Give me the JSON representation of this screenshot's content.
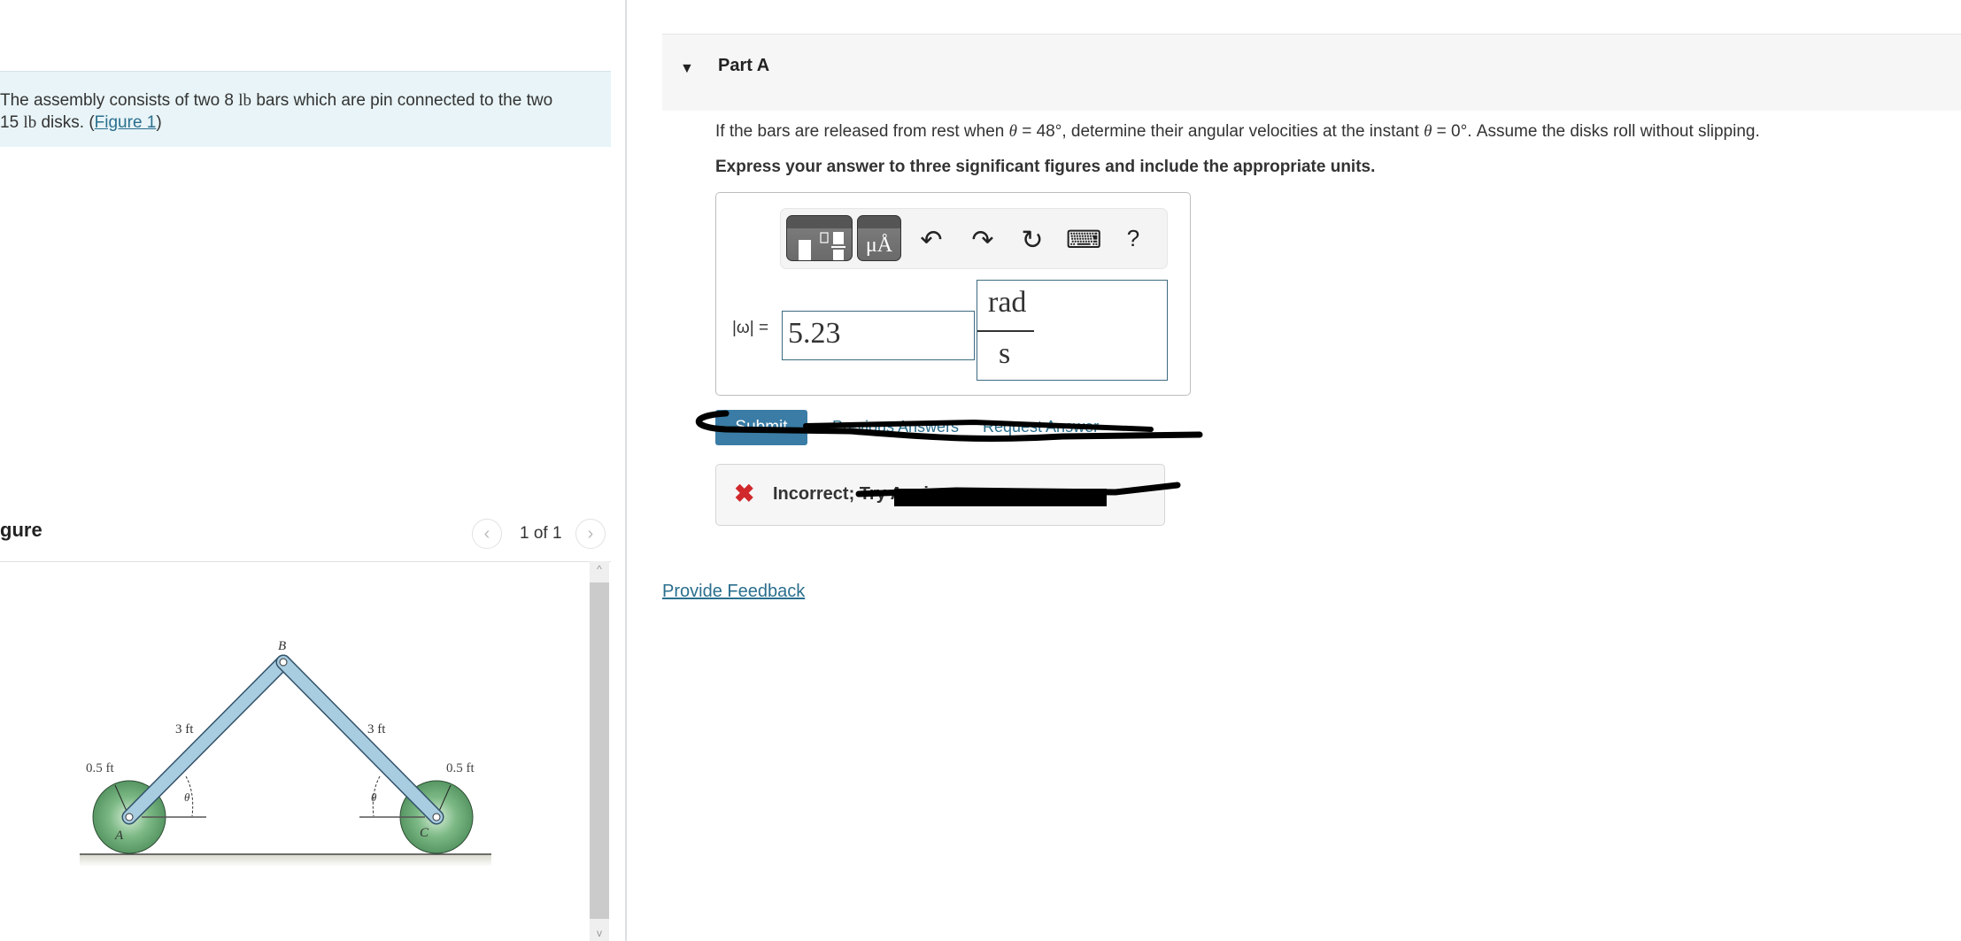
{
  "left_panel": {
    "intro": {
      "text_before": "The assembly consists of two 8 ",
      "unit1": "lb",
      "text_mid": " bars which are pin connected to the two",
      "line2_prefix": "15 ",
      "unit2": "lb",
      "text_after": " disks. (",
      "figure_link": "Figure 1",
      "close_paren": ")"
    },
    "figure": {
      "title": "gure",
      "pager": "1 of 1",
      "prev_icon": "chevron-left",
      "next_icon": "chevron-right",
      "labels": {
        "point_b": "B",
        "point_a": "A",
        "point_c": "C",
        "bar_left_length": "3 ft",
        "bar_right_length": "3 ft",
        "radius_left": "0.5 ft",
        "radius_right": "0.5 ft",
        "angle_left": "θ",
        "angle_right": "θ"
      },
      "colors": {
        "bar": "#a8cce0",
        "disk": "#6fae7a"
      }
    }
  },
  "part_a": {
    "caret": "▼",
    "label": "Part A",
    "question": {
      "p1": "If the bars are released from rest when ",
      "theta1": "θ",
      "p2": " = 48°, determine their angular velocities at the instant ",
      "theta2": "θ",
      "p3": " = 0°. Assume the disks roll without slipping."
    },
    "instruction": "Express your answer to three significant figures and include the appropriate units.",
    "toolbar": {
      "templates_icon": "fraction-template-icon",
      "units_label": "μÅ",
      "undo": "↶",
      "redo": "↷",
      "reset": "↻",
      "keyboard": "⌨",
      "help": "?"
    },
    "answer": {
      "label": "|ω| =",
      "value": "5.23",
      "unit_numerator": "rad",
      "unit_denominator": "s"
    },
    "submit_label": "Submit",
    "previous_answers_label": "Previous Answers",
    "request_answer_label": "Request Answer",
    "feedback": {
      "icon": "✖",
      "text": "Incorrect; Try Again"
    },
    "colors": {
      "accent": "#3a7ca5",
      "error": "#d0282b"
    }
  },
  "footer": {
    "provide_feedback": "Provide Feedback"
  }
}
